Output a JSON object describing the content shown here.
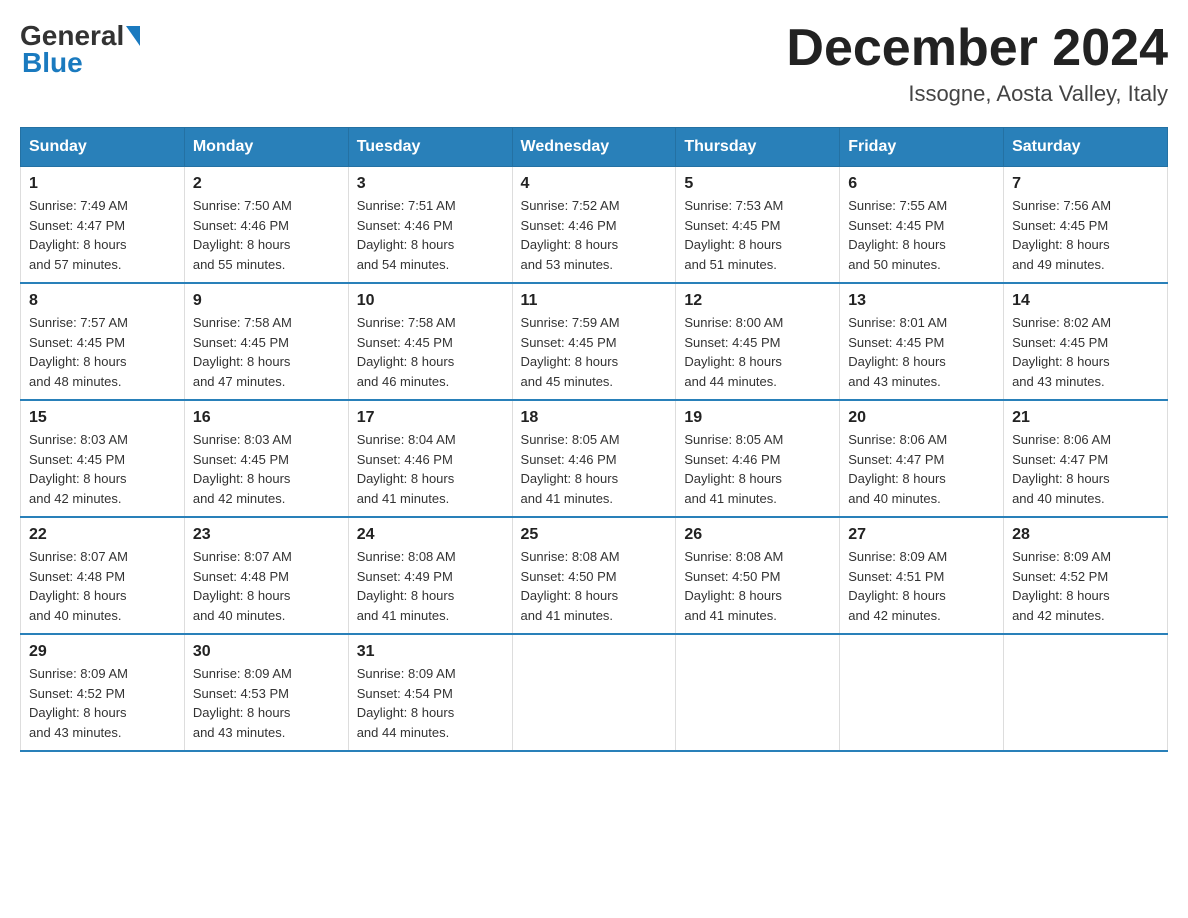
{
  "logo": {
    "general": "General",
    "blue": "Blue"
  },
  "header": {
    "month": "December 2024",
    "location": "Issogne, Aosta Valley, Italy"
  },
  "days_of_week": [
    "Sunday",
    "Monday",
    "Tuesday",
    "Wednesday",
    "Thursday",
    "Friday",
    "Saturday"
  ],
  "weeks": [
    [
      {
        "day": "1",
        "sunrise": "7:49 AM",
        "sunset": "4:47 PM",
        "daylight": "8 hours and 57 minutes."
      },
      {
        "day": "2",
        "sunrise": "7:50 AM",
        "sunset": "4:46 PM",
        "daylight": "8 hours and 55 minutes."
      },
      {
        "day": "3",
        "sunrise": "7:51 AM",
        "sunset": "4:46 PM",
        "daylight": "8 hours and 54 minutes."
      },
      {
        "day": "4",
        "sunrise": "7:52 AM",
        "sunset": "4:46 PM",
        "daylight": "8 hours and 53 minutes."
      },
      {
        "day": "5",
        "sunrise": "7:53 AM",
        "sunset": "4:45 PM",
        "daylight": "8 hours and 51 minutes."
      },
      {
        "day": "6",
        "sunrise": "7:55 AM",
        "sunset": "4:45 PM",
        "daylight": "8 hours and 50 minutes."
      },
      {
        "day": "7",
        "sunrise": "7:56 AM",
        "sunset": "4:45 PM",
        "daylight": "8 hours and 49 minutes."
      }
    ],
    [
      {
        "day": "8",
        "sunrise": "7:57 AM",
        "sunset": "4:45 PM",
        "daylight": "8 hours and 48 minutes."
      },
      {
        "day": "9",
        "sunrise": "7:58 AM",
        "sunset": "4:45 PM",
        "daylight": "8 hours and 47 minutes."
      },
      {
        "day": "10",
        "sunrise": "7:58 AM",
        "sunset": "4:45 PM",
        "daylight": "8 hours and 46 minutes."
      },
      {
        "day": "11",
        "sunrise": "7:59 AM",
        "sunset": "4:45 PM",
        "daylight": "8 hours and 45 minutes."
      },
      {
        "day": "12",
        "sunrise": "8:00 AM",
        "sunset": "4:45 PM",
        "daylight": "8 hours and 44 minutes."
      },
      {
        "day": "13",
        "sunrise": "8:01 AM",
        "sunset": "4:45 PM",
        "daylight": "8 hours and 43 minutes."
      },
      {
        "day": "14",
        "sunrise": "8:02 AM",
        "sunset": "4:45 PM",
        "daylight": "8 hours and 43 minutes."
      }
    ],
    [
      {
        "day": "15",
        "sunrise": "8:03 AM",
        "sunset": "4:45 PM",
        "daylight": "8 hours and 42 minutes."
      },
      {
        "day": "16",
        "sunrise": "8:03 AM",
        "sunset": "4:45 PM",
        "daylight": "8 hours and 42 minutes."
      },
      {
        "day": "17",
        "sunrise": "8:04 AM",
        "sunset": "4:46 PM",
        "daylight": "8 hours and 41 minutes."
      },
      {
        "day": "18",
        "sunrise": "8:05 AM",
        "sunset": "4:46 PM",
        "daylight": "8 hours and 41 minutes."
      },
      {
        "day": "19",
        "sunrise": "8:05 AM",
        "sunset": "4:46 PM",
        "daylight": "8 hours and 41 minutes."
      },
      {
        "day": "20",
        "sunrise": "8:06 AM",
        "sunset": "4:47 PM",
        "daylight": "8 hours and 40 minutes."
      },
      {
        "day": "21",
        "sunrise": "8:06 AM",
        "sunset": "4:47 PM",
        "daylight": "8 hours and 40 minutes."
      }
    ],
    [
      {
        "day": "22",
        "sunrise": "8:07 AM",
        "sunset": "4:48 PM",
        "daylight": "8 hours and 40 minutes."
      },
      {
        "day": "23",
        "sunrise": "8:07 AM",
        "sunset": "4:48 PM",
        "daylight": "8 hours and 40 minutes."
      },
      {
        "day": "24",
        "sunrise": "8:08 AM",
        "sunset": "4:49 PM",
        "daylight": "8 hours and 41 minutes."
      },
      {
        "day": "25",
        "sunrise": "8:08 AM",
        "sunset": "4:50 PM",
        "daylight": "8 hours and 41 minutes."
      },
      {
        "day": "26",
        "sunrise": "8:08 AM",
        "sunset": "4:50 PM",
        "daylight": "8 hours and 41 minutes."
      },
      {
        "day": "27",
        "sunrise": "8:09 AM",
        "sunset": "4:51 PM",
        "daylight": "8 hours and 42 minutes."
      },
      {
        "day": "28",
        "sunrise": "8:09 AM",
        "sunset": "4:52 PM",
        "daylight": "8 hours and 42 minutes."
      }
    ],
    [
      {
        "day": "29",
        "sunrise": "8:09 AM",
        "sunset": "4:52 PM",
        "daylight": "8 hours and 43 minutes."
      },
      {
        "day": "30",
        "sunrise": "8:09 AM",
        "sunset": "4:53 PM",
        "daylight": "8 hours and 43 minutes."
      },
      {
        "day": "31",
        "sunrise": "8:09 AM",
        "sunset": "4:54 PM",
        "daylight": "8 hours and 44 minutes."
      },
      null,
      null,
      null,
      null
    ]
  ],
  "labels": {
    "sunrise": "Sunrise:",
    "sunset": "Sunset:",
    "daylight": "Daylight:"
  }
}
